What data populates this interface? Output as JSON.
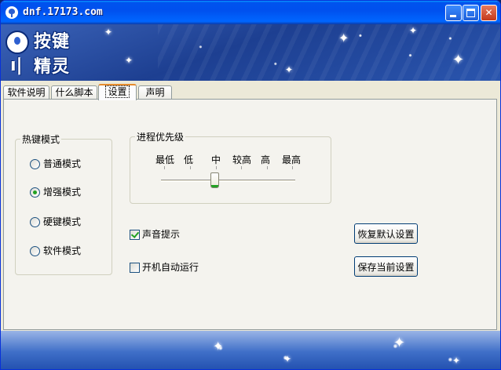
{
  "window": {
    "title": "dnf.17173.com"
  },
  "logo": {
    "line1": "按键",
    "line2": "精灵"
  },
  "tabs": [
    {
      "label": "软件说明",
      "active": false
    },
    {
      "label": "什么脚本",
      "active": false
    },
    {
      "label": "设置",
      "active": true
    },
    {
      "label": "声明",
      "active": false
    }
  ],
  "hotkey": {
    "title": "热键模式",
    "options": [
      {
        "label": "普通模式",
        "checked": false
      },
      {
        "label": "增强模式",
        "checked": true
      },
      {
        "label": "硬键模式",
        "checked": false
      },
      {
        "label": "软件模式",
        "checked": false
      }
    ]
  },
  "priority": {
    "title": "进程优先级",
    "levels": [
      "最低",
      "低",
      "中",
      "较高",
      "高",
      "最高"
    ],
    "selected": "中"
  },
  "options": {
    "sound": {
      "label": "声音提示",
      "checked": true
    },
    "autorun": {
      "label": "开机自动运行",
      "checked": false
    }
  },
  "buttons": {
    "restore": "恢复默认设置",
    "save": "保存当前设置"
  },
  "colors": {
    "accent": "#0053ee",
    "check": "#21a121"
  }
}
